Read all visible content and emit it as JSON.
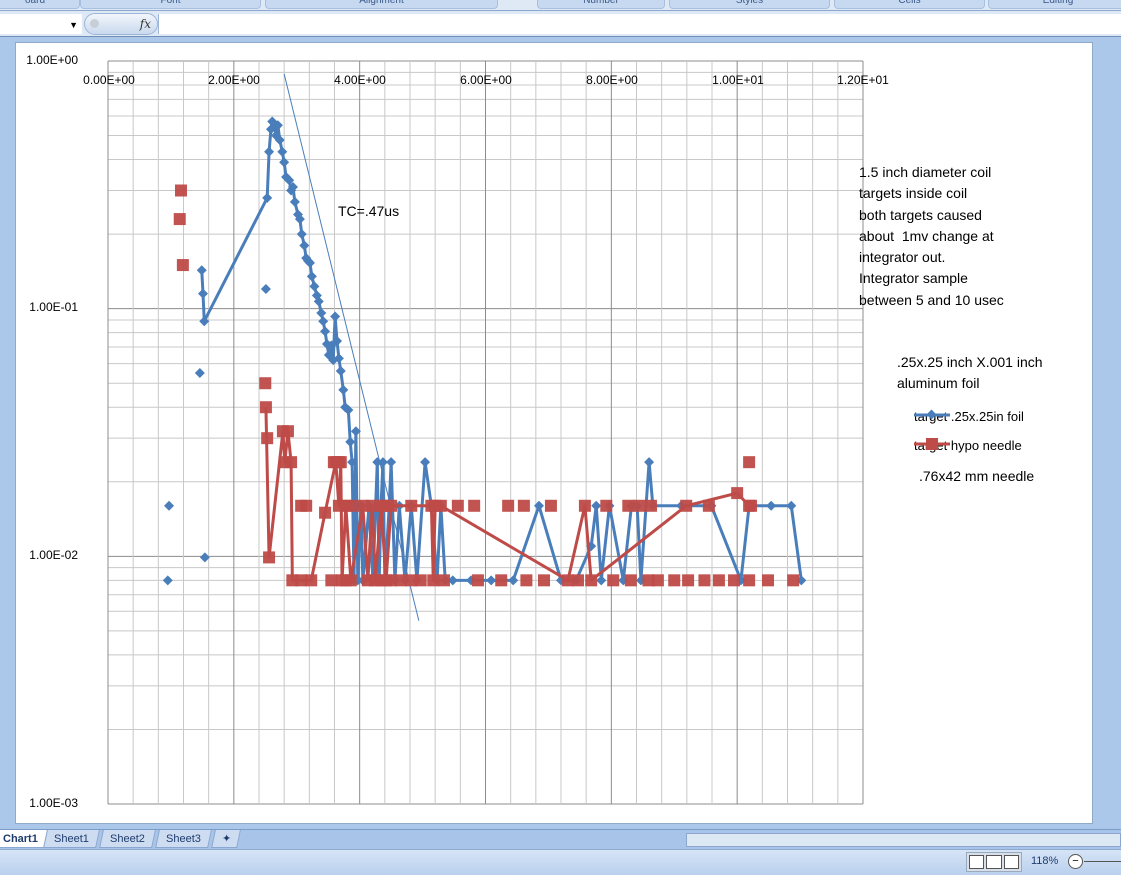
{
  "ribbon": {
    "groups": [
      "oard",
      "Font",
      "Alignment",
      "Number",
      "Styles",
      "Cells",
      "Editing"
    ]
  },
  "formula_bar": {
    "name_box": "",
    "fx_label": "fx",
    "value": ""
  },
  "chart": {
    "y_ticks": [
      "1.00E+00",
      "1.00E-01",
      "1.00E-02",
      "1.00E-03"
    ],
    "x_ticks": [
      "0.00E+00",
      "2.00E+00",
      "4.00E+00",
      "6.00E+00",
      "8.00E+00",
      "1.00E+01",
      "1.20E+01"
    ],
    "trend_label": "TC=.47us",
    "note_main": "1.5 inch diameter coil\ntargets inside coil\nboth targets caused\nabout  1mv change at\nintegrator out.\nIntegrator sample\nbetween 5 and 10 usec",
    "note_foil": ".25x.25 inch X.001 inch\naluminum foil",
    "note_needle": ".76x42 mm needle",
    "legend": [
      "target .25x.25in foil",
      "target hypo needle"
    ]
  },
  "chart_data": {
    "type": "scatter",
    "x_axis": {
      "min": 0,
      "max": 12,
      "major": 2,
      "minor": 0.4,
      "position": "top"
    },
    "y_axis": {
      "scale": "log",
      "min": 0.001,
      "max": 1
    },
    "grid": true,
    "legend_placement": "right",
    "series": [
      {
        "name": "target .25x.25in foil",
        "color": "#4a7ebb",
        "marker": "diamond",
        "points": [
          [
            1.49,
            0.143
          ],
          [
            1.51,
            0.115
          ],
          [
            1.53,
            0.089
          ],
          [
            2.53,
            0.28
          ],
          [
            2.56,
            0.43
          ],
          [
            2.59,
            0.53
          ],
          [
            2.61,
            0.57
          ],
          [
            2.64,
            0.56
          ],
          [
            2.67,
            0.5
          ],
          [
            2.7,
            0.55
          ],
          [
            2.73,
            0.48
          ],
          [
            2.77,
            0.43
          ],
          [
            2.8,
            0.39
          ],
          [
            2.83,
            0.34
          ],
          [
            2.88,
            0.33
          ],
          [
            2.91,
            0.3
          ],
          [
            2.94,
            0.31
          ],
          [
            2.97,
            0.27
          ],
          [
            3.02,
            0.24
          ],
          [
            3.05,
            0.23
          ],
          [
            3.08,
            0.2
          ],
          [
            3.12,
            0.18
          ],
          [
            3.15,
            0.16
          ],
          [
            3.18,
            0.156
          ],
          [
            3.21,
            0.153
          ],
          [
            3.24,
            0.135
          ],
          [
            3.28,
            0.123
          ],
          [
            3.32,
            0.113
          ],
          [
            3.35,
            0.107
          ],
          [
            3.39,
            0.096
          ],
          [
            3.42,
            0.089
          ],
          [
            3.45,
            0.081
          ],
          [
            3.48,
            0.072
          ],
          [
            3.51,
            0.065
          ],
          [
            3.55,
            0.071
          ],
          [
            3.58,
            0.062
          ],
          [
            3.61,
            0.093
          ],
          [
            3.64,
            0.074
          ],
          [
            3.67,
            0.063
          ],
          [
            3.7,
            0.056
          ],
          [
            3.74,
            0.047
          ],
          [
            3.77,
            0.04
          ],
          [
            3.82,
            0.039
          ],
          [
            3.85,
            0.029
          ],
          [
            3.88,
            0.024
          ],
          [
            3.91,
            0.008
          ],
          [
            3.94,
            0.032
          ],
          [
            3.97,
            0.008
          ],
          [
            4.02,
            0.016
          ],
          [
            4.05,
            0.008
          ],
          [
            4.15,
            0.016
          ],
          [
            4.21,
            0.008
          ],
          [
            4.28,
            0.024
          ],
          [
            4.31,
            0.008
          ],
          [
            4.34,
            0.016
          ],
          [
            4.37,
            0.024
          ],
          [
            4.4,
            0.008
          ],
          [
            4.47,
            0.016
          ],
          [
            4.5,
            0.024
          ],
          [
            4.56,
            0.008
          ],
          [
            4.63,
            0.016
          ],
          [
            4.72,
            0.008
          ],
          [
            4.82,
            0.016
          ],
          [
            4.91,
            0.008
          ],
          [
            5.04,
            0.024
          ],
          [
            5.14,
            0.016
          ],
          [
            5.23,
            0.008
          ],
          [
            5.29,
            0.016
          ],
          [
            5.36,
            0.008
          ],
          [
            5.48,
            0.008
          ],
          [
            5.77,
            0.008
          ],
          [
            6.09,
            0.008
          ],
          [
            6.44,
            0.008
          ],
          [
            6.85,
            0.016
          ],
          [
            7.2,
            0.008
          ],
          [
            7.44,
            0.008
          ],
          [
            7.68,
            0.011
          ],
          [
            7.76,
            0.016
          ],
          [
            7.84,
            0.008
          ],
          [
            7.97,
            0.016
          ],
          [
            8.19,
            0.008
          ],
          [
            8.32,
            0.016
          ],
          [
            8.41,
            0.016
          ],
          [
            8.47,
            0.008
          ],
          [
            8.6,
            0.024
          ],
          [
            8.66,
            0.016
          ],
          [
            9.11,
            0.016
          ],
          [
            9.59,
            0.016
          ],
          [
            10.06,
            0.008
          ],
          [
            10.19,
            0.016
          ],
          [
            10.54,
            0.016
          ],
          [
            10.86,
            0.016
          ],
          [
            11.02,
            0.008
          ]
        ],
        "markers": [
          [
            0.95,
            0.008
          ],
          [
            0.97,
            0.016
          ],
          [
            1.46,
            0.055
          ],
          [
            1.54,
            0.0099
          ],
          [
            2.51,
            0.12
          ]
        ]
      },
      {
        "name": "target hypo needle",
        "color": "#be4b48",
        "marker": "square",
        "points": [
          [
            2.51,
            0.04
          ],
          [
            2.56,
            0.0099
          ],
          [
            2.78,
            0.032
          ],
          [
            2.81,
            0.024
          ],
          [
            2.86,
            0.032
          ],
          [
            2.91,
            0.024
          ],
          [
            2.93,
            0.008
          ],
          [
            3.07,
            0.008
          ],
          [
            3.23,
            0.008
          ],
          [
            3.45,
            0.015
          ],
          [
            3.62,
            0.024
          ],
          [
            3.67,
            0.016
          ],
          [
            3.7,
            0.024
          ],
          [
            3.72,
            0.008
          ],
          [
            3.78,
            0.016
          ],
          [
            3.86,
            0.008
          ],
          [
            4.05,
            0.016
          ],
          [
            4.13,
            0.008
          ],
          [
            4.2,
            0.016
          ],
          [
            4.25,
            0.008
          ],
          [
            4.34,
            0.016
          ],
          [
            4.42,
            0.008
          ],
          [
            4.5,
            0.016
          ],
          [
            5.14,
            0.016
          ],
          [
            5.17,
            0.008
          ],
          [
            5.2,
            0.016
          ],
          [
            5.29,
            0.016
          ],
          [
            7.31,
            0.008
          ],
          [
            7.58,
            0.016
          ],
          [
            7.68,
            0.008
          ],
          [
            9.19,
            0.016
          ],
          [
            10.0,
            0.018
          ],
          [
            10.19,
            0.016
          ]
        ],
        "markers": [
          [
            1.16,
            0.3
          ],
          [
            1.14,
            0.23
          ],
          [
            1.19,
            0.15
          ],
          [
            2.5,
            0.05
          ],
          [
            2.53,
            0.03
          ],
          [
            3.07,
            0.016
          ],
          [
            3.15,
            0.016
          ],
          [
            3.59,
            0.024
          ],
          [
            3.67,
            0.024
          ],
          [
            3.86,
            0.016
          ],
          [
            4.42,
            0.016
          ],
          [
            4.82,
            0.016
          ],
          [
            3.55,
            0.008
          ],
          [
            3.78,
            0.008
          ],
          [
            4.34,
            0.008
          ],
          [
            4.5,
            0.008
          ],
          [
            4.66,
            0.008
          ],
          [
            4.82,
            0.008
          ],
          [
            4.97,
            0.008
          ],
          [
            5.56,
            0.016
          ],
          [
            5.82,
            0.016
          ],
          [
            6.36,
            0.016
          ],
          [
            6.61,
            0.016
          ],
          [
            7.04,
            0.016
          ],
          [
            7.92,
            0.016
          ],
          [
            8.27,
            0.016
          ],
          [
            8.44,
            0.016
          ],
          [
            8.63,
            0.016
          ],
          [
            9.55,
            0.016
          ],
          [
            10.22,
            0.016
          ],
          [
            5.34,
            0.008
          ],
          [
            5.88,
            0.008
          ],
          [
            6.25,
            0.008
          ],
          [
            6.65,
            0.008
          ],
          [
            6.93,
            0.008
          ],
          [
            7.47,
            0.008
          ],
          [
            8.03,
            0.008
          ],
          [
            8.31,
            0.008
          ],
          [
            8.59,
            0.008
          ],
          [
            8.74,
            0.008
          ],
          [
            9.0,
            0.008
          ],
          [
            9.22,
            0.008
          ],
          [
            9.48,
            0.008
          ],
          [
            9.71,
            0.008
          ],
          [
            9.95,
            0.008
          ],
          [
            10.19,
            0.008
          ],
          [
            10.49,
            0.008
          ],
          [
            10.89,
            0.008
          ],
          [
            10.19,
            0.024
          ]
        ]
      }
    ],
    "trendline": {
      "series": "target .25x.25in foil",
      "from": [
        2.8,
        0.886
      ],
      "to": [
        4.94,
        0.0055
      ],
      "label": "TC=.47us"
    }
  },
  "sheet_tabs": [
    "Chart1",
    "Sheet1",
    "Sheet2",
    "Sheet3"
  ],
  "status": {
    "zoom": "118%"
  }
}
